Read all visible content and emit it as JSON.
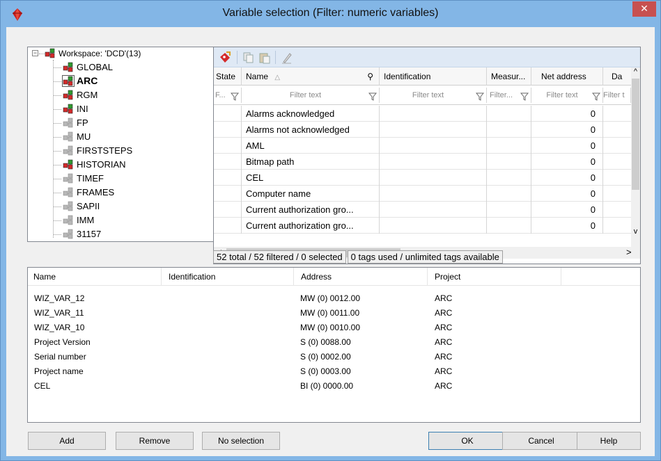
{
  "window": {
    "title": "Variable selection (Filter: numeric variables)",
    "close_glyph": "✕"
  },
  "tree": {
    "root": {
      "label": "Workspace: 'DCD'(13)",
      "expander": "−"
    },
    "items": [
      {
        "label": "GLOBAL",
        "active": true,
        "selected": false
      },
      {
        "label": "ARC",
        "active": true,
        "selected": true
      },
      {
        "label": "RGM",
        "active": true,
        "selected": false
      },
      {
        "label": "INI",
        "active": true,
        "selected": false
      },
      {
        "label": "FP",
        "active": false,
        "selected": false
      },
      {
        "label": "MU",
        "active": false,
        "selected": false
      },
      {
        "label": "FIRSTSTEPS",
        "active": false,
        "selected": false
      },
      {
        "label": "HISTORIAN",
        "active": true,
        "selected": false
      },
      {
        "label": "TIMEF",
        "active": false,
        "selected": false
      },
      {
        "label": "FRAMES",
        "active": false,
        "selected": false
      },
      {
        "label": "SAPII",
        "active": false,
        "selected": false
      },
      {
        "label": "IMM",
        "active": false,
        "selected": false
      },
      {
        "label": "31157",
        "active": false,
        "selected": false
      }
    ]
  },
  "grid": {
    "columns": [
      {
        "label": "State"
      },
      {
        "label": "Name",
        "sort_glyph": "△",
        "search_glyph": "⚲"
      },
      {
        "label": "Identification"
      },
      {
        "label": "Measur..."
      },
      {
        "label": "Net address"
      },
      {
        "label": "Da"
      }
    ],
    "filters": [
      "F...",
      "Filter text",
      "Filter text",
      "Filter...",
      "Filter text",
      "Filter t"
    ],
    "rows": [
      {
        "name": "Alarms acknowledged",
        "net": "0"
      },
      {
        "name": "Alarms not acknowledged",
        "net": "0"
      },
      {
        "name": "AML",
        "net": "0"
      },
      {
        "name": "Bitmap path",
        "net": "0"
      },
      {
        "name": "CEL",
        "net": "0"
      },
      {
        "name": "Computer name",
        "net": "0"
      },
      {
        "name": "Current authorization gro...",
        "net": "0"
      },
      {
        "name": "Current authorization gro...",
        "net": "0"
      }
    ],
    "status_counts": "52 total / 52 filtered / 0 selected",
    "status_tags": "0 tags used / unlimited tags available",
    "scroll": {
      "up": "^",
      "down": "v",
      "left": "<",
      "right": ">"
    }
  },
  "selection": {
    "columns": [
      "Name",
      "Identification",
      "Address",
      "Project"
    ],
    "rows": [
      {
        "name": "WIZ_VAR_12",
        "id": "",
        "address": "MW (0) 0012.00",
        "project": "ARC"
      },
      {
        "name": "WIZ_VAR_11",
        "id": "",
        "address": "MW (0) 0011.00",
        "project": "ARC"
      },
      {
        "name": "WIZ_VAR_10",
        "id": "",
        "address": "MW (0) 0010.00",
        "project": "ARC"
      },
      {
        "name": "Project Version",
        "id": "",
        "address": "S (0) 0088.00",
        "project": "ARC"
      },
      {
        "name": "Serial number",
        "id": "",
        "address": "S (0) 0002.00",
        "project": "ARC"
      },
      {
        "name": "Project name",
        "id": "",
        "address": "S (0) 0003.00",
        "project": "ARC"
      },
      {
        "name": "CEL",
        "id": "",
        "address": "BI (0) 0000.00",
        "project": "ARC"
      }
    ]
  },
  "buttons": {
    "add": "Add",
    "remove": "Remove",
    "no_selection": "No selection",
    "ok": "OK",
    "cancel": "Cancel",
    "help": "Help"
  },
  "colors": {
    "title_bar": "#83b6e6",
    "close_button": "#c75050",
    "icon_active_red": "#d42a2a",
    "icon_active_green": "#2f9a2f",
    "icon_inactive": "#b8b8b8"
  }
}
